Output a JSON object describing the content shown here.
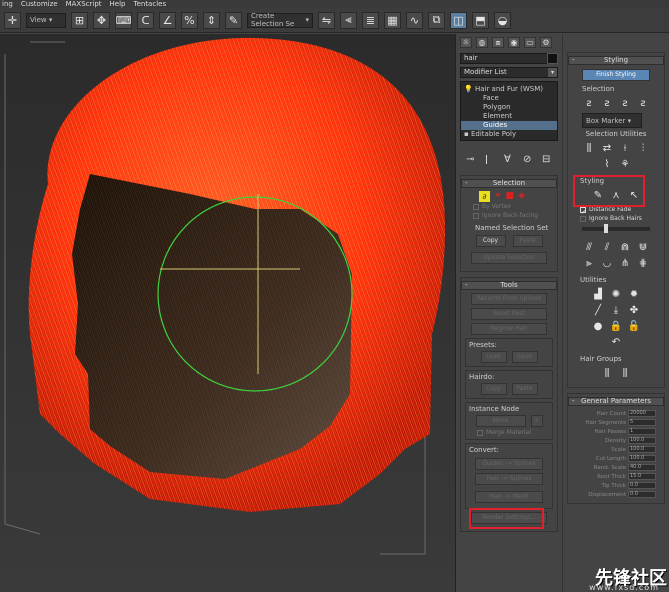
{
  "menu": [
    "ing",
    "Customize",
    "MAXScript",
    "Help",
    "Tentacles"
  ],
  "toolbar": {
    "view_dropdown": "View",
    "selection_set_dropdown": "Create Selection Se"
  },
  "object_name": "hair",
  "modifier_list": "Modifier List",
  "stack": {
    "items": [
      "Hair and Fur (WSM)",
      "Face",
      "Polygon",
      "Element",
      "Guides",
      "Editable Poly"
    ]
  },
  "selection": {
    "title": "Selection",
    "by_vertex": "By Vertex",
    "ignore_back": "Ignore Back-facing",
    "named_set": "Named Selection Set",
    "copy": "Copy",
    "paste": "Paste",
    "update": "Update Selection"
  },
  "tools": {
    "title": "Tools",
    "recomb": "Recomb From Splines",
    "reset_rest": "Reset Rest",
    "regrow": "Regrow Hair",
    "presets": "Presets:",
    "load": "Load",
    "save": "Save",
    "hairdo": "Hairdo:",
    "copy": "Copy",
    "paste": "Paste",
    "instance_node": "Instance Node",
    "none": "None",
    "merge": "Merge Material",
    "convert": "Convert:",
    "guides_splines": "Guides -> Splines",
    "hair_splines": "Hair -> Splines",
    "hair_mesh": "Hair -> Mesh",
    "render_settings": "Render Settings..."
  },
  "styling": {
    "title": "Styling",
    "finish": "Finish Styling",
    "selection": "Selection",
    "box_marker": "Box Marker",
    "selection_utilities": "Selection Utilities",
    "styling_label": "Styling",
    "distance_fade": "Distance Fade",
    "ignore_back_hairs": "Ignore Back Hairs",
    "utilities": "Utilities",
    "hair_groups": "Hair Groups"
  },
  "general": {
    "title": "General Parameters",
    "params": [
      {
        "label": "Hair Count",
        "value": "20000"
      },
      {
        "label": "Hair Segments",
        "value": "5"
      },
      {
        "label": "Hair Passes",
        "value": "1"
      },
      {
        "label": "Density",
        "value": "100.0"
      },
      {
        "label": "Scale",
        "value": "100.0"
      },
      {
        "label": "Cut Length",
        "value": "100.0"
      },
      {
        "label": "Rand. Scale",
        "value": "40.0"
      },
      {
        "label": "Root Thick",
        "value": "15.0"
      },
      {
        "label": "Tip Thick",
        "value": "0.0"
      },
      {
        "label": "Displacement",
        "value": "0.0"
      }
    ]
  },
  "watermark": {
    "logo": "先锋社区",
    "url": "www.fxsd.com"
  },
  "colors": {
    "hair": "#ff3a10",
    "highlight": "#e0202a",
    "gizmo": "#3fd23f"
  }
}
